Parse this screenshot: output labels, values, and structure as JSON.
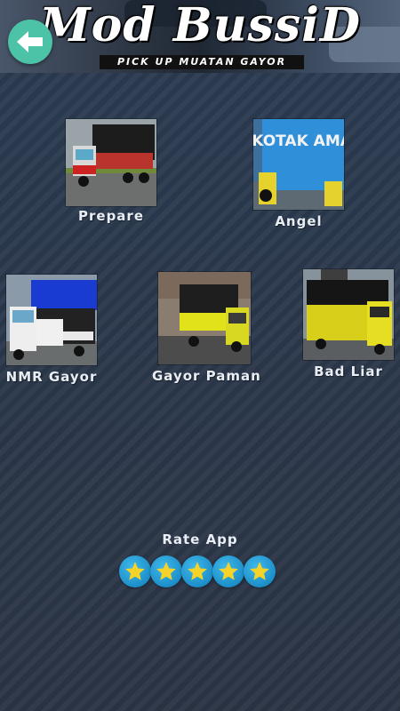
{
  "header": {
    "title": "Mod BussiD",
    "subtitle": "PICK UP MUATAN GAYOR"
  },
  "items": [
    {
      "label": "Prepare"
    },
    {
      "label": "Angel"
    },
    {
      "label": "NMR Gayor"
    },
    {
      "label": "Gayor Paman"
    },
    {
      "label": "Bad Liar"
    }
  ],
  "rating": {
    "label": "Rate App",
    "stars": 5
  },
  "thumb_text": {
    "angel_sign": "KOTAK AMAL"
  },
  "colors": {
    "back_button": "#4cc2a6",
    "star_button": "#1d8fc9",
    "star": "#f5d328"
  }
}
